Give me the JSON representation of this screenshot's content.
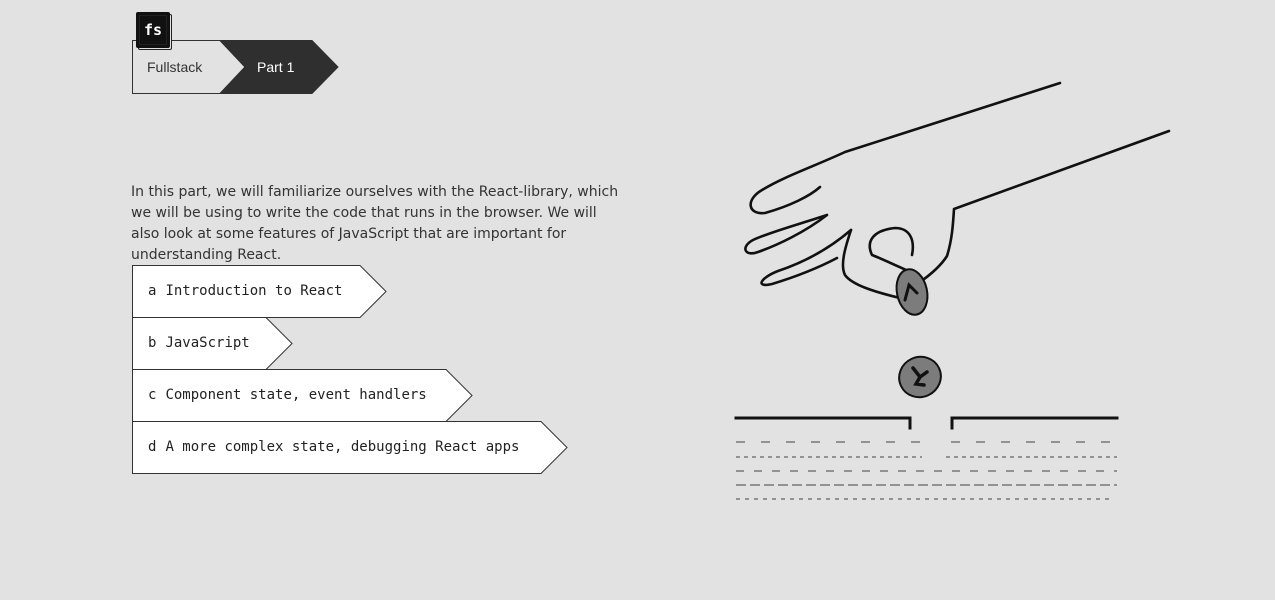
{
  "logo": {
    "text": "fs"
  },
  "breadcrumb": [
    {
      "label": "Fullstack"
    },
    {
      "label": "Part 1"
    }
  ],
  "intro": "In this part, we will familiarize ourselves with the React-library, which we will be using to write the code that runs in the browser. We will also look at some features of JavaScript that are important for understanding React.",
  "sections": [
    {
      "letter": "a",
      "title": "Introduction to React"
    },
    {
      "letter": "b",
      "title": "JavaScript"
    },
    {
      "letter": "c",
      "title": "Component state, event handlers"
    },
    {
      "letter": "d",
      "title": "A more complex state, debugging React apps"
    }
  ],
  "colors": {
    "background": "#e2e2e2",
    "dark": "#2f2f2f",
    "coin": "#7c7c7c"
  }
}
